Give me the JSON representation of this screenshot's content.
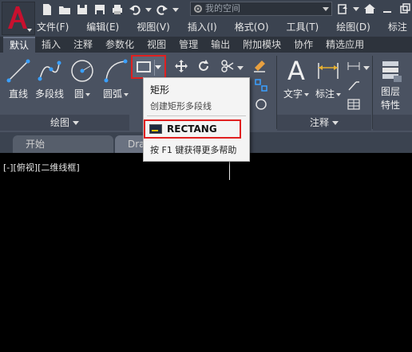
{
  "quick_access": {
    "workspace_placeholder": "我的空间"
  },
  "menu": [
    "文件(F)",
    "编辑(E)",
    "视图(V)",
    "插入(I)",
    "格式(O)",
    "工具(T)",
    "绘图(D)",
    "标注"
  ],
  "ribbon_tabs": [
    "默认",
    "插入",
    "注释",
    "参数化",
    "视图",
    "管理",
    "输出",
    "附加模块",
    "协作",
    "精选应用"
  ],
  "draw_panel": {
    "tools": [
      "直线",
      "多段线",
      "圆",
      "圆弧"
    ],
    "footer": "绘图"
  },
  "annotation_panel": {
    "text": "文字",
    "dimension": "标注",
    "footer": "注释"
  },
  "layers_panel": {
    "label_line1": "图层",
    "label_line2": "特性"
  },
  "doc_tabs": [
    "开始",
    "Draw"
  ],
  "viewport_label": "[-][俯视][二维线框]",
  "tooltip": {
    "title": "矩形",
    "description": "创建矩形多段线",
    "command": "RECTANG",
    "help": "按 F1 键获得更多帮助"
  },
  "colors": {
    "highlight_red": "#e02020",
    "ribbon_bg": "#4a5261",
    "logo_red": "#c8102e"
  }
}
